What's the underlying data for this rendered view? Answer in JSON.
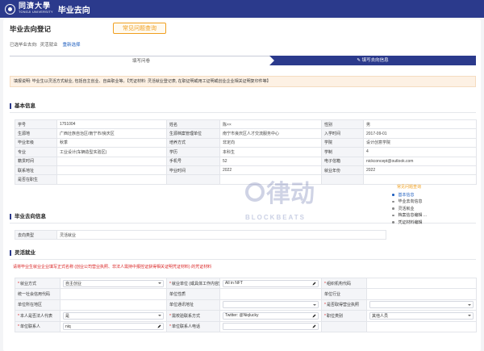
{
  "header": {
    "logo_cn": "同濟大學",
    "logo_en": "TONGJI UNIVERSITY",
    "app_title": "毕业去向"
  },
  "page": {
    "title": "毕业去向登记",
    "faq_button": "常见问题查询",
    "selected_label": "已选毕业去向:",
    "selected_value": "灵活就业",
    "reselect_link": "重新选择"
  },
  "steps": [
    {
      "label": "填写问卷",
      "active": false
    },
    {
      "label": "填写去向信息",
      "active": true
    }
  ],
  "notice": "填报说明: 毕业生以灵活方式就业, 包括自主创业、自由职业等。【凭证材料: 灵活就业登记表, 在职证明或用工证明或创业企业相关证明复印件等】",
  "basic_info": {
    "title": "基本信息",
    "rows": [
      [
        {
          "label": "学号",
          "value": "1751004"
        },
        {
          "label": "姓名",
          "value": "陈××"
        },
        {
          "label": "性别",
          "value": "男"
        }
      ],
      [
        {
          "label": "生源地",
          "value": "广西壮族自治区/南宁市/良庆区"
        },
        {
          "label": "生源档案管理单位",
          "value": "南宁市良庆区人才交流服务中心"
        },
        {
          "label": "入学时间",
          "value": "2017-09-01"
        }
      ],
      [
        {
          "label": "毕业年级",
          "value": "秋季"
        },
        {
          "label": "培养方式",
          "value": "非定向"
        },
        {
          "label": "学院",
          "value": "设计创意学院"
        }
      ],
      [
        {
          "label": "专业",
          "value": "工业设计(车辆造型实验区)"
        },
        {
          "label": "学历",
          "value": "本科生"
        },
        {
          "label": "学制",
          "value": "4"
        }
      ],
      [
        {
          "label": "籍贯时间",
          "value": ""
        },
        {
          "label": "手机号",
          "value": "52"
        },
        {
          "label": "电子信箱",
          "value": "nickconcept@outlook.com"
        }
      ],
      [
        {
          "label": "联系地址",
          "value": ""
        },
        {
          "label": "毕业时间",
          "value": "2022"
        },
        {
          "label": "就业年份",
          "value": "2022"
        }
      ],
      [
        {
          "label": "是否在职生",
          "value": ""
        }
      ]
    ]
  },
  "destination": {
    "title": "毕业去向信息",
    "type_label": "去向类型",
    "type_value": "灵活就业"
  },
  "flexible": {
    "title": "灵活就业",
    "warning": "请将毕业生就业企业填写正式名称 (创业公司营业执照、非法人需持中报控证获得相关证明凭证材料) 的凭证材料",
    "rows": [
      [
        {
          "label": "就业方式",
          "req": true,
          "value": "自主创业",
          "kind": "select"
        },
        {
          "label": "就业单位 (或具体工作内容)",
          "req": true,
          "value": "All in NFT",
          "kind": "edit"
        },
        {
          "label": "组织机构代码",
          "req": true,
          "value": "",
          "kind": "text"
        }
      ],
      [
        {
          "label": "统一社会信用代码",
          "req": false,
          "value": "",
          "kind": "text"
        },
        {
          "label": "单位性质",
          "req": false,
          "value": "",
          "kind": "text"
        },
        {
          "label": "单位行业",
          "req": false,
          "value": "",
          "kind": "text"
        }
      ],
      [
        {
          "label": "单位所在地区",
          "req": false,
          "value": "",
          "kind": "text"
        },
        {
          "label": "单位通讯地址",
          "req": false,
          "value": "",
          "kind": "select"
        },
        {
          "label": "是否取得营业执照",
          "req": true,
          "value": "",
          "kind": "select"
        }
      ],
      [
        {
          "label": "本人是否法人代表",
          "req": true,
          "value": "是",
          "kind": "select"
        },
        {
          "label": "需校验联系方式",
          "req": true,
          "value": "Twitter: @Niqlucky",
          "kind": "edit"
        },
        {
          "label": "职位类别",
          "req": true,
          "value": "其他人员",
          "kind": "select"
        }
      ],
      [
        {
          "label": "单位联系人",
          "req": true,
          "value": "niq",
          "kind": "edit"
        },
        {
          "label": "单位联系人电话",
          "req": true,
          "value": "",
          "kind": "edit"
        },
        {
          "label": "",
          "req": false,
          "value": "",
          "kind": "text"
        }
      ]
    ]
  },
  "float_nav": {
    "head": "常见问题查询",
    "items": [
      {
        "label": "基本信息",
        "active": true
      },
      {
        "label": "毕业去向信息",
        "active": false
      },
      {
        "label": "灵活就业",
        "active": false
      },
      {
        "label": "档案信息编辑 ...",
        "active": false
      },
      {
        "label": "凭证材料编辑",
        "active": false
      }
    ]
  },
  "watermark": "BLOCKBEATS",
  "watermark_cn": "律动"
}
